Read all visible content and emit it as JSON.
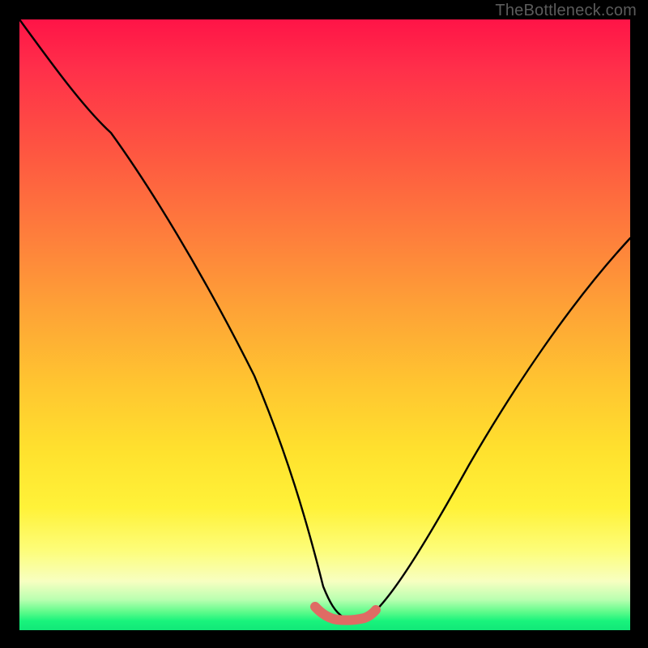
{
  "watermark": "TheBottleneck.com",
  "colors": {
    "background": "#000000",
    "curve_main": "#000000",
    "curve_highlight": "#df6b64",
    "gradient_stops": [
      "#ff1447",
      "#ff2f4a",
      "#fe5741",
      "#fe7d3c",
      "#fea436",
      "#ffc630",
      "#ffe22e",
      "#fff239",
      "#fdfd7a",
      "#f7ffc1",
      "#b9ffb0",
      "#5ffb8b",
      "#19f37c",
      "#11e878"
    ]
  },
  "chart_data": {
    "type": "line",
    "title": "",
    "xlabel": "",
    "ylabel": "",
    "xlim": [
      0,
      100
    ],
    "ylim": [
      0,
      100
    ],
    "series": [
      {
        "name": "bottleneck-curve",
        "x": [
          0,
          5,
          10,
          15,
          20,
          25,
          30,
          35,
          40,
          45,
          48,
          50,
          52,
          55,
          57,
          60,
          65,
          70,
          75,
          80,
          85,
          90,
          95,
          100
        ],
        "values": [
          100,
          93,
          85,
          77,
          69,
          60,
          51,
          42,
          32,
          21,
          13,
          7,
          4,
          2,
          2,
          3,
          7,
          13,
          21,
          29,
          38,
          46,
          55,
          64
        ]
      },
      {
        "name": "highlight-segment",
        "x": [
          48,
          50,
          52,
          55,
          57
        ],
        "values": [
          3.0,
          2.2,
          1.8,
          1.8,
          2.4
        ]
      }
    ],
    "annotations": []
  }
}
